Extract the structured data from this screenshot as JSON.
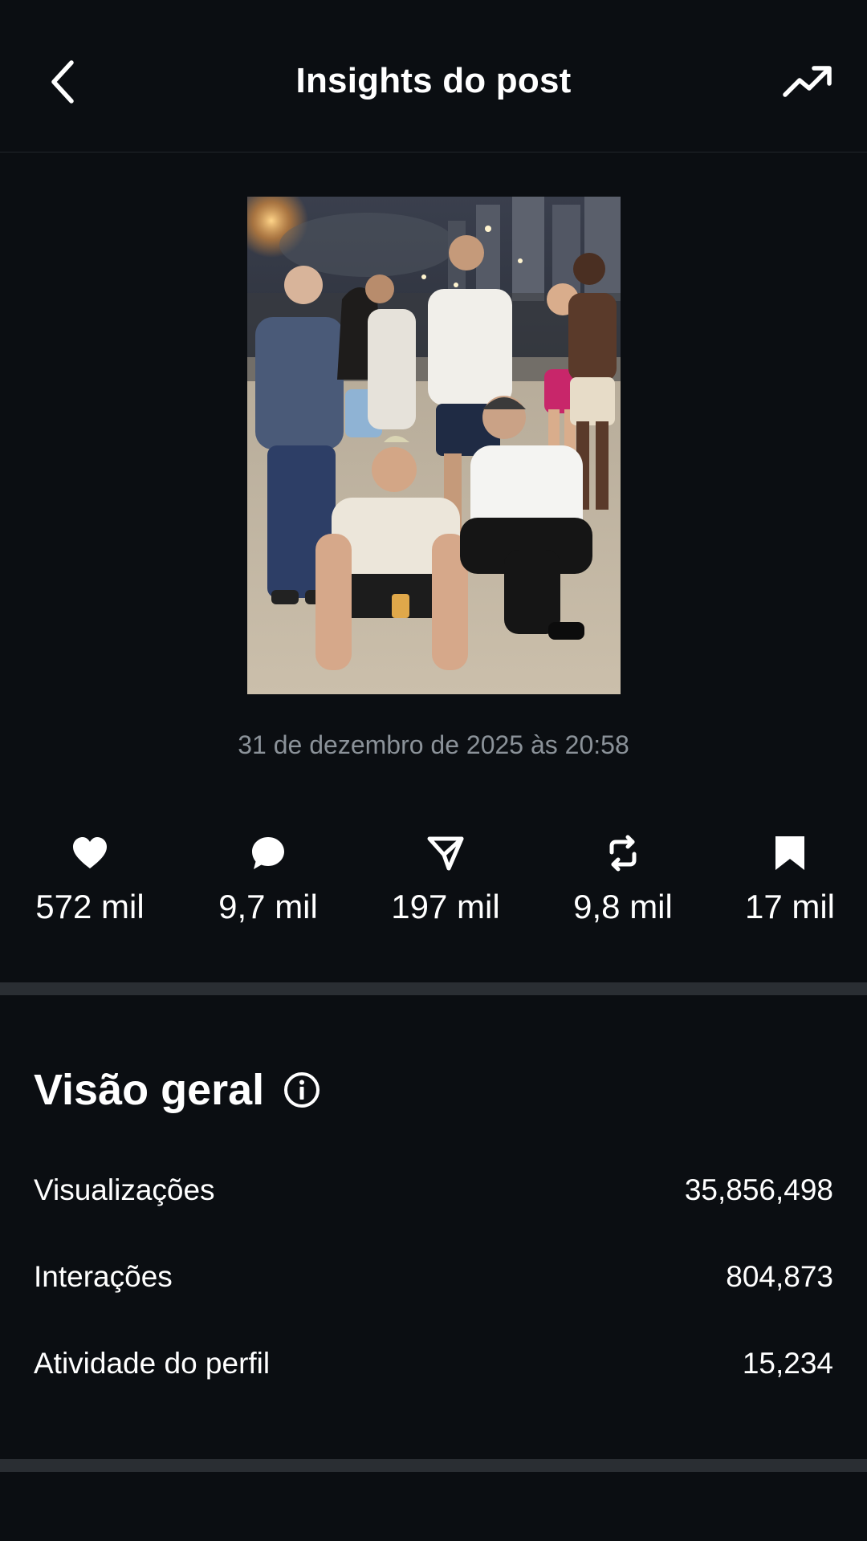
{
  "header": {
    "title": "Insights do post"
  },
  "icons": {
    "back": "chevron-left-icon",
    "trend": "trending-up-icon",
    "info": "info-icon"
  },
  "post": {
    "timestamp": "31 de dezembro de 2025 às 20:58"
  },
  "stats": [
    {
      "icon": "heart-icon",
      "value": "572 mil"
    },
    {
      "icon": "comment-icon",
      "value": "9,7 mil"
    },
    {
      "icon": "share-icon",
      "value": "197 mil"
    },
    {
      "icon": "repost-icon",
      "value": "9,8 mil"
    },
    {
      "icon": "bookmark-icon",
      "value": "17 mil"
    }
  ],
  "overview": {
    "title": "Visão geral",
    "rows": [
      {
        "label": "Visualizações",
        "value": "35,856,498"
      },
      {
        "label": "Interações",
        "value": "804,873"
      },
      {
        "label": "Atividade do perfil",
        "value": "15,234"
      }
    ]
  },
  "colors": {
    "background": "#0b0e12",
    "divider": "#2a2e33",
    "secondary_text": "#8b9299"
  }
}
